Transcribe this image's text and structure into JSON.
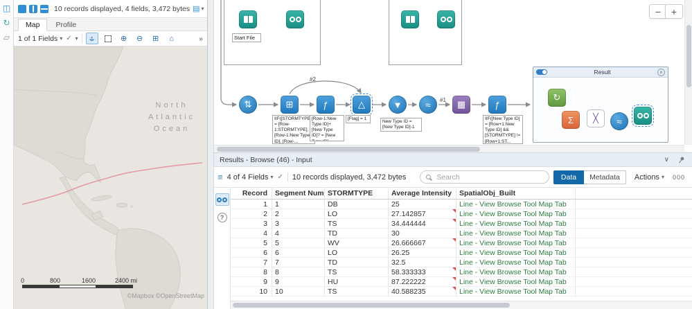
{
  "colors": {
    "accent_blue": "#1b75bb",
    "data_button_blue": "#1268a8",
    "link_green": "#2e7d3e",
    "flag_red": "#d9534f",
    "track_pink": "#e59aa4"
  },
  "icons": {
    "caret_down": "▾",
    "check": "✓",
    "chevron_right_double": "»",
    "pan_h": "↔",
    "pan_v": "↕",
    "zoom_in": "⊕",
    "zoom_out": "⊖",
    "zoom_extent": "⊞",
    "home": "⌂",
    "rows": "≡",
    "collapse_chevron": "∨",
    "container_collapse": "∧",
    "minus": "−",
    "plus": "+",
    "more": "000",
    "report": "▤",
    "panels": "◫",
    "refresh": "↻",
    "tag": "▱",
    "help": "?"
  },
  "tool_glyphs": {
    "sort": "⇅",
    "multirow": "⊞",
    "formula": "ƒ",
    "triangle": "△",
    "funnel": "▼",
    "wave": "≈",
    "tile": "▦",
    "sigma": "Σ",
    "generate": "↻",
    "cross": "╳"
  },
  "map_panel": {
    "toolbar": {
      "summary": "10 records displayed, 4 fields, 3,472 bytes"
    },
    "tabs": {
      "map": "Map",
      "profile": "Profile"
    },
    "map_toolbar": {
      "fields_selector": "1 of 1 Fields"
    },
    "map": {
      "ocean_label": {
        "line1": "North",
        "line2": "Atlantic",
        "line3": "Ocean"
      },
      "scale_labels": [
        "0",
        "800",
        "1600",
        "2400 mi"
      ],
      "attribution": "©Mapbox ©OpenStreetMap"
    }
  },
  "canvas": {
    "wire_labels": {
      "l2": "#2",
      "l1": "#1"
    },
    "annotations": {
      "start_file": "Start File",
      "a1": "IIF([STORMTYPE] = [Row-1:STORMTYPE], [Row-1:New Type ID], [Row-...",
      "a2": "[Row-1:New Type ID]+ [New Type ID]? = [New Type ID]...",
      "a3": "[Flag] = 1",
      "a4": "New Type ID = [New Type ID]-1",
      "a5": "IIF([New Type ID] = [Row+1:New Type ID] && [STORMTYPE] != [Row+1:ST..."
    },
    "container": {
      "title": "Result"
    }
  },
  "results": {
    "title": "Results - Browse (46) - Input",
    "toolbar": {
      "fields_selector": "4 of 4 Fields",
      "summary": "10 records displayed, 3,472 bytes",
      "search_placeholder": "Search",
      "data_label": "Data",
      "metadata_label": "Metadata",
      "actions_label": "Actions"
    },
    "table": {
      "columns": [
        "Record",
        "Segment Number",
        "STORMTYPE",
        "Average Intensity",
        "SpatialObj_Built"
      ],
      "rows": [
        {
          "record": "1",
          "segment": "1",
          "stormtype": "DB",
          "intensity": "25",
          "spatial": "Line - View Browse Tool Map Tab",
          "flagged": false
        },
        {
          "record": "2",
          "segment": "2",
          "stormtype": "LO",
          "intensity": "27.142857",
          "spatial": "Line - View Browse Tool Map Tab",
          "flagged": true
        },
        {
          "record": "3",
          "segment": "3",
          "stormtype": "TS",
          "intensity": "34.444444",
          "spatial": "Line - View Browse Tool Map Tab",
          "flagged": true
        },
        {
          "record": "4",
          "segment": "4",
          "stormtype": "TD",
          "intensity": "30",
          "spatial": "Line - View Browse Tool Map Tab",
          "flagged": false
        },
        {
          "record": "5",
          "segment": "5",
          "stormtype": "WV",
          "intensity": "26.666667",
          "spatial": "Line - View Browse Tool Map Tab",
          "flagged": true
        },
        {
          "record": "6",
          "segment": "6",
          "stormtype": "LO",
          "intensity": "26.25",
          "spatial": "Line - View Browse Tool Map Tab",
          "flagged": false
        },
        {
          "record": "7",
          "segment": "7",
          "stormtype": "TD",
          "intensity": "32.5",
          "spatial": "Line - View Browse Tool Map Tab",
          "flagged": false
        },
        {
          "record": "8",
          "segment": "8",
          "stormtype": "TS",
          "intensity": "58.333333",
          "spatial": "Line - View Browse Tool Map Tab",
          "flagged": true
        },
        {
          "record": "9",
          "segment": "9",
          "stormtype": "HU",
          "intensity": "87.222222",
          "spatial": "Line - View Browse Tool Map Tab",
          "flagged": true
        },
        {
          "record": "10",
          "segment": "10",
          "stormtype": "TS",
          "intensity": "40.588235",
          "spatial": "Line - View Browse Tool Map Tab",
          "flagged": true
        }
      ]
    }
  }
}
